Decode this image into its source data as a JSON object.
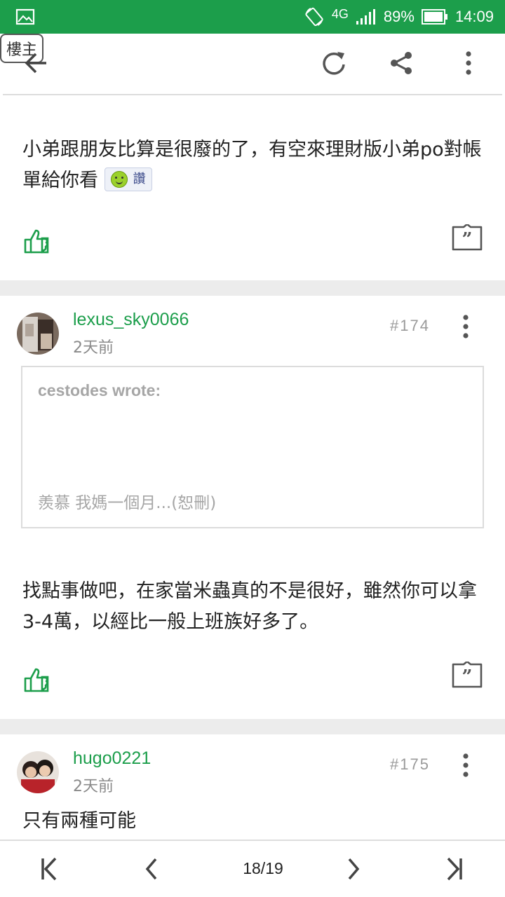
{
  "status_bar": {
    "network": "4G",
    "battery": "89%",
    "time": "14:09",
    "icons": [
      "gallery-icon",
      "rotate-icon",
      "signal-icon",
      "battery-icon"
    ]
  },
  "toolbar": {
    "op_label": "樓主",
    "icons": [
      "back-arrow-icon",
      "refresh-icon",
      "share-icon",
      "more-vert-icon"
    ]
  },
  "posts": [
    {
      "text": "小弟跟朋友比算是很廢的了，有空來理財版小弟po對帳單給你看",
      "emoji_label": "讚"
    },
    {
      "username": "lexus_sky0066",
      "time": "2天前",
      "floor": "#174",
      "quote": {
        "author": "cestodes wrote:",
        "body": "羨慕 我媽一個月...(恕刪)"
      },
      "text": "找點事做吧，在家當米蟲真的不是很好，雖然你可以拿3-4萬，以經比一般上班族好多了。"
    },
    {
      "username": "hugo0221",
      "time": "2天前",
      "floor": "#175",
      "text": "只有兩種可能"
    }
  ],
  "pagination": {
    "current": "18/19"
  },
  "colors": {
    "brand_green": "#1c9e4b",
    "separator": "#ececec"
  }
}
